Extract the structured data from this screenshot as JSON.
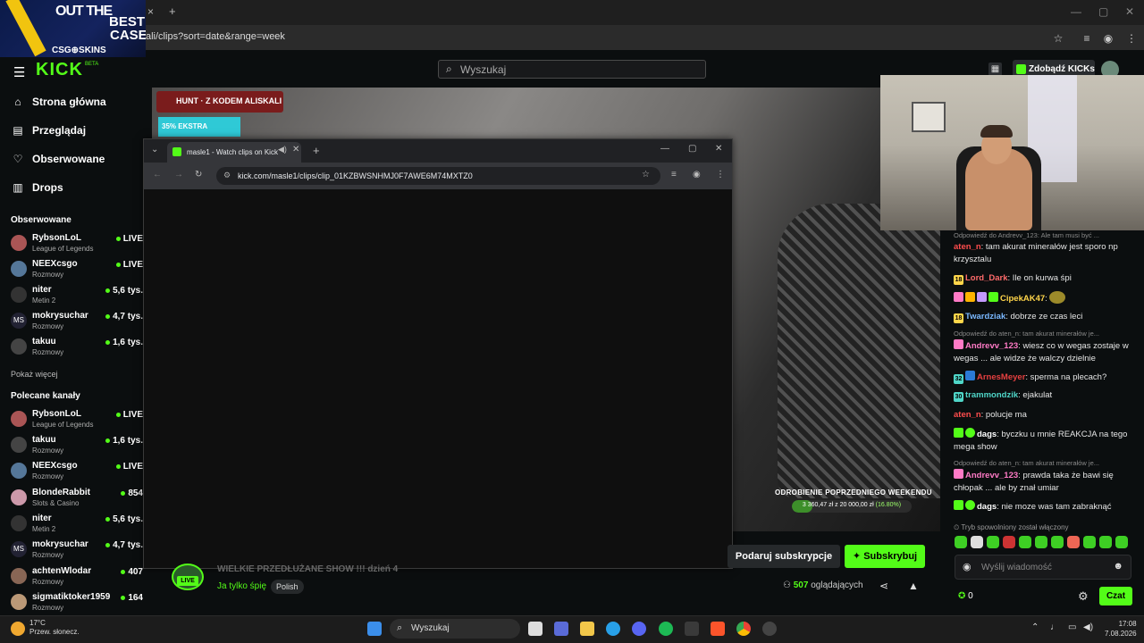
{
  "browser": {
    "address": "ali/clips?sort=date&range=week",
    "new_tab": "+",
    "close_tab": "×"
  },
  "ad": {
    "line1": "OUT THE",
    "line2": "BEST",
    "line3": "CASE",
    "brand": "CSG⊕SKINS"
  },
  "kick": {
    "logo": "KICK",
    "beta": "BETA",
    "nav": [
      {
        "label": "Strona główna",
        "icon": "home-icon"
      },
      {
        "label": "Przeglądaj",
        "icon": "browse-icon"
      },
      {
        "label": "Obserwowane",
        "icon": "heart-icon"
      },
      {
        "label": "Drops",
        "icon": "drops-icon"
      }
    ],
    "followed_title": "Obserwowane",
    "followed": [
      {
        "name": "RybsonLoL",
        "category": "League of Legends",
        "status": "LIVE"
      },
      {
        "name": "NEEXcsgo",
        "category": "Rozmowy",
        "status": "LIVE"
      },
      {
        "name": "niter",
        "category": "Metin 2",
        "status": "5,6 tys."
      },
      {
        "name": "mokrysuchar",
        "category": "Rozmowy",
        "status": "4,7 tys."
      },
      {
        "name": "takuu",
        "category": "Rozmowy",
        "status": "1,6 tys."
      }
    ],
    "show_more": "Pokaż więcej",
    "recommended_title": "Polecane kanały",
    "recommended": [
      {
        "name": "RybsonLoL",
        "category": "League of Legends",
        "status": "LIVE"
      },
      {
        "name": "takuu",
        "category": "Rozmowy",
        "status": "1,6 tys."
      },
      {
        "name": "NEEXcsgo",
        "category": "Rozmowy",
        "status": "LIVE"
      },
      {
        "name": "BlondeRabbit",
        "category": "Slots & Casino",
        "status": "854"
      },
      {
        "name": "niter",
        "category": "Metin 2",
        "status": "5,6 tys."
      },
      {
        "name": "mokrysuchar",
        "category": "Rozmowy",
        "status": "4,7 tys."
      },
      {
        "name": "achtenWlodar",
        "category": "Rozmowy",
        "status": "407"
      },
      {
        "name": "sigmatiktoker1959",
        "category": "Rozmowy",
        "status": "164"
      }
    ],
    "search_placeholder": "Wyszukaj",
    "get_kicks": "Zdobądź KICKs"
  },
  "stream": {
    "overlay_ad1": "HUNT · Z KODEM ALISKALI",
    "overlay_ad2": "35% EKSTRA",
    "goal_title": "ODROBIENIE POPRZEDNIEGO WEEKENDU",
    "goal_amount": "3 360,47 zł",
    "goal_sep": "z",
    "goal_target": "20 000,00 zł",
    "goal_pct": "(16.80%)",
    "goal_fraction": 0.168,
    "title": "WIELKIE PRZEDŁUŻANE SHOW !!! dzień 4",
    "category": "Ja tylko śpię",
    "tag": "Polish",
    "live": "LIVE",
    "gift_button": "Podaruj subskrypcje",
    "subscribe_button": "Subskrybuj",
    "viewers_count": "507",
    "viewers_label": "oglądających"
  },
  "popup": {
    "tab_title": "masle1 - Watch clips on Kick",
    "url": "kick.com/masle1/clips/clip_01KZBWSNHMJ0F7AWE6M74MXTZ0"
  },
  "chat": {
    "messages": [
      {
        "type": "reply",
        "text": "Odpowiedź do Andrevv_123: Ale tam musi być ..."
      },
      {
        "user": "aten_n",
        "color": "#ff4d4d",
        "text": "tam akurat minerałów jest sporo np krzysztalu"
      },
      {
        "user": "Lord_Dark",
        "color": "#ff6b6b",
        "text": "Ile on kurwa śpi"
      },
      {
        "user": "CipekAK47",
        "color": "#ffd54a",
        "text": ""
      },
      {
        "user": "Twardziak",
        "color": "#7ab8ff",
        "text": "dobrze ze czas leci"
      },
      {
        "type": "reply",
        "text": "Odpowiedź do aten_n: tam akurat minerałów je..."
      },
      {
        "user": "Andrevv_123",
        "color": "#ff7ac6",
        "text": "wiesz co w wegas zostaje w wegas ... ale widze że walczy dzielnie"
      },
      {
        "user": "ArnesMeyer",
        "color": "#e64040",
        "text": "sperma na plecach?"
      },
      {
        "user": "trammondzik",
        "color": "#4fd6c8",
        "text": "ejakulat"
      },
      {
        "user": "aten_n",
        "color": "#ff4d4d",
        "text": "polucje ma"
      },
      {
        "user": "dags",
        "color": "#ffffff",
        "text": "byczku u mnie REAKCJA na tego mega show"
      },
      {
        "type": "reply",
        "text": "Odpowiedź do aten_n: tam akurat minerałów je..."
      },
      {
        "user": "Andrevv_123",
        "color": "#ff7ac6",
        "text": "prawda taka że bawi się chłopak ... ale by znał umiar"
      },
      {
        "user": "dags",
        "color": "#ffffff",
        "text": "nie moze was tam zabraknąć"
      }
    ],
    "slow_mode": "Tryb spowolniony został włączony",
    "input_placeholder": "Wyślij wiadomość",
    "kicks": "0",
    "send_button": "Czat"
  },
  "taskbar": {
    "temp": "17°C",
    "weather": "Przew. słonecz.",
    "search": "Wyszukaj",
    "time": "17:08",
    "date": "7.08.2026"
  },
  "colors": {
    "accent": "#53fc18",
    "bg": "#0b0e0f"
  }
}
